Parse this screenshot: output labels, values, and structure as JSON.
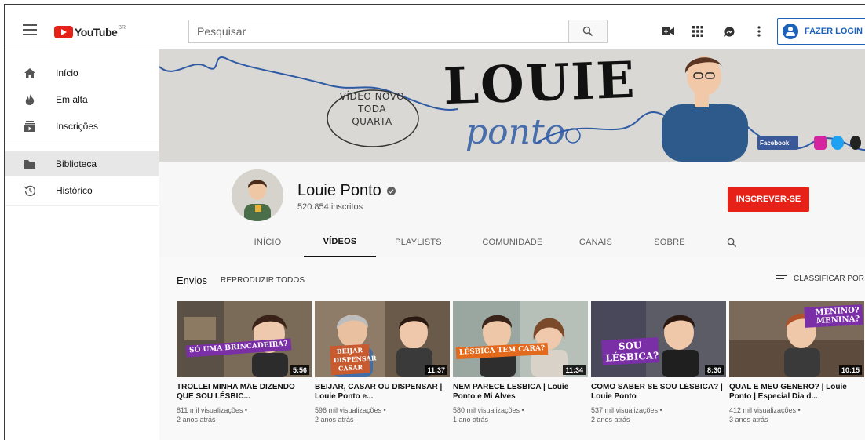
{
  "header": {
    "logo_text": "YouTube",
    "logo_region": "BR",
    "search_placeholder": "Pesquisar",
    "login_label": "FAZER LOGIN",
    "icons": [
      "menu-icon",
      "search-icon",
      "create-video-icon",
      "apps-grid-icon",
      "messages-icon",
      "more-vert-icon",
      "account-icon"
    ]
  },
  "sidebar": {
    "items": [
      {
        "label": "Início",
        "icon": "home-icon"
      },
      {
        "label": "Em alta",
        "icon": "trending-icon"
      },
      {
        "label": "Inscrições",
        "icon": "subscriptions-icon"
      },
      {
        "label": "Biblioteca",
        "icon": "library-icon"
      },
      {
        "label": "Histórico",
        "icon": "history-icon"
      }
    ]
  },
  "banner": {
    "badge_line1": "VÍDEO NOVO",
    "badge_line2": "TODA QUARTA",
    "title": "LOUIE",
    "script": "ponto",
    "social_facebook": "Facebook"
  },
  "channel": {
    "name": "Louie Ponto",
    "subscribers": "520.854 inscritos",
    "subscribe_label": "INSCREVER-SE",
    "tabs": [
      "INÍCIO",
      "VÍDEOS",
      "PLAYLISTS",
      "COMUNIDADE",
      "CANAIS",
      "SOBRE"
    ],
    "active_tab": "VÍDEOS"
  },
  "uploads": {
    "section_title": "Envios",
    "play_all_label": "REPRODUZIR TODOS",
    "sort_label": "CLASSIFICAR POR",
    "videos": [
      {
        "title": "TROLLEI MINHA MÃE DIZENDO QUE SOU LÉSBIC...",
        "views": "811 mil visualizações •",
        "age": "2 anos atrás",
        "duration": "5:56",
        "overlay": "SÓ UMA BRINCADEIRA?"
      },
      {
        "title": "BEIJAR, CASAR OU DISPENSAR | Louie Ponto e...",
        "views": "596 mil visualizações •",
        "age": "2 anos atrás",
        "duration": "11:37",
        "overlay": "BEIJAR DISPENSAR CASAR"
      },
      {
        "title": "NEM PARECE LESBICA | Louie Ponto e Mi Alves",
        "views": "580 mil visualizações •",
        "age": "1 ano atrás",
        "duration": "11:34",
        "overlay": "LÉSBICA TEM CARA?"
      },
      {
        "title": "COMO SABER SE SOU LÉSBICA? | Louie Ponto",
        "views": "537 mil visualizações •",
        "age": "2 anos atrás",
        "duration": "8:30",
        "overlay": "SOU LÉSBICA?"
      },
      {
        "title": "QUAL E MEU GENERO? | Louie Ponto | Especial Dia d...",
        "views": "412 mil visualizações •",
        "age": "3 anos atrás",
        "duration": "10:15",
        "overlay": "MENINO? MENINA?"
      }
    ]
  },
  "colors": {
    "brand_red": "#e62117",
    "link_blue": "#1c62b9",
    "purple_overlay": "#7b2fa6"
  }
}
